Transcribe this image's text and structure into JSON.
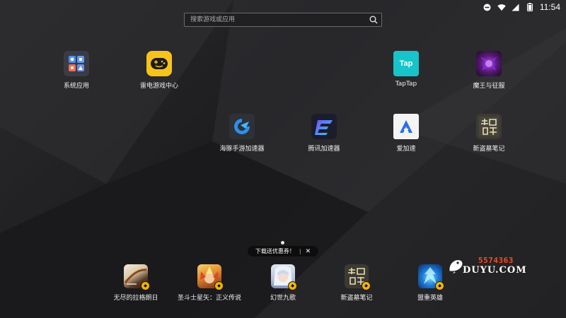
{
  "status_bar": {
    "time": "11:54",
    "icons": [
      "do-not-disturb-icon",
      "wifi-icon",
      "signal-icon",
      "battery-icon"
    ]
  },
  "search": {
    "placeholder": "搜索游戏或应用"
  },
  "apps": {
    "system": "系统应用",
    "leidian": "雷电游戏中心",
    "taptap": "TapTap",
    "taptap_icon_text": "Tap",
    "mowang": "魔王与征服",
    "haitun": "海豚手游加速器",
    "tengxun": "腾讯加速器",
    "aijiasu": "爱加速",
    "daomu": "新盗墓笔记"
  },
  "banner": {
    "text": "下载送优惠券！",
    "close": "✕"
  },
  "dock": [
    {
      "label": "无尽的拉格朗日"
    },
    {
      "label": "圣斗士星矢：正义传说"
    },
    {
      "label": "幻世九歌"
    },
    {
      "label": "新盗墓笔记"
    },
    {
      "label": "盟重英雄"
    }
  ],
  "watermark": {
    "number": "5574363",
    "brand": "DUYU.COM"
  },
  "colors": {
    "accent_yellow": "#f7c31a",
    "taptap": "#16c4c9",
    "badge": "#f0b400",
    "watermark_num": "#ff4a1a"
  }
}
